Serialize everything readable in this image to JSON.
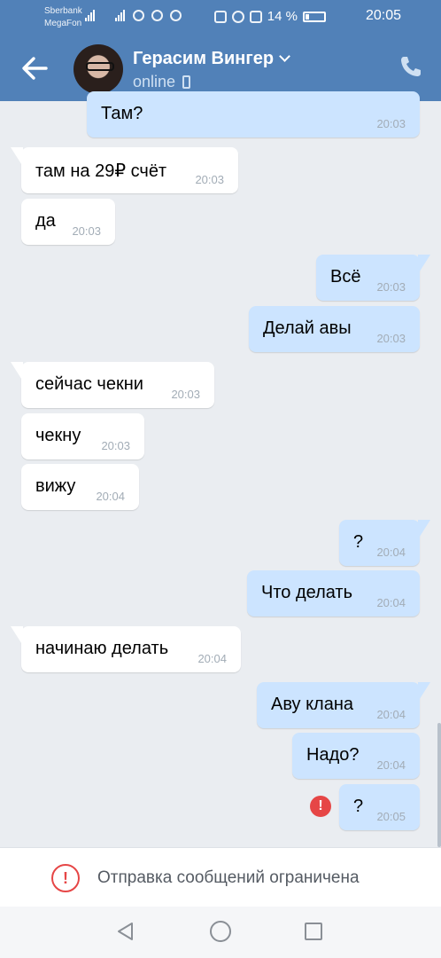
{
  "status_bar": {
    "carrier1": "Sberbank",
    "carrier2": "MegaFon",
    "network": "4G",
    "battery": "14 %",
    "time": "20:05"
  },
  "header": {
    "contact_name": "Герасим Вингер",
    "presence": "online",
    "accent_color": "#5181b8"
  },
  "messages": [
    {
      "dir": "out",
      "text": "Там?",
      "time": "20:03"
    },
    {
      "dir": "in",
      "text": "там на 29₽ счёт",
      "time": "20:03"
    },
    {
      "dir": "in",
      "text": "да",
      "time": "20:03"
    },
    {
      "dir": "out",
      "text": "Всё",
      "time": "20:03"
    },
    {
      "dir": "out",
      "text": "Делай авы",
      "time": "20:03"
    },
    {
      "dir": "in",
      "text": "сейчас чекни",
      "time": "20:03"
    },
    {
      "dir": "in",
      "text": "чекну",
      "time": "20:03"
    },
    {
      "dir": "in",
      "text": "вижу",
      "time": "20:04"
    },
    {
      "dir": "out",
      "text": "?",
      "time": "20:04"
    },
    {
      "dir": "out",
      "text": "Что делать",
      "time": "20:04"
    },
    {
      "dir": "in",
      "text": "начинаю делать",
      "time": "20:04"
    },
    {
      "dir": "out",
      "text": "Аву клана",
      "time": "20:04"
    },
    {
      "dir": "out",
      "text": "Надо?",
      "time": "20:04"
    },
    {
      "dir": "out",
      "text": "?",
      "time": "20:05",
      "failed": true
    }
  ],
  "restriction": {
    "text": "Отправка сообщений ограничена",
    "icon": "warning-circle-icon"
  },
  "icons": {
    "back": "arrow-left-icon",
    "call": "phone-icon",
    "error": "exclamation-circle-icon"
  }
}
